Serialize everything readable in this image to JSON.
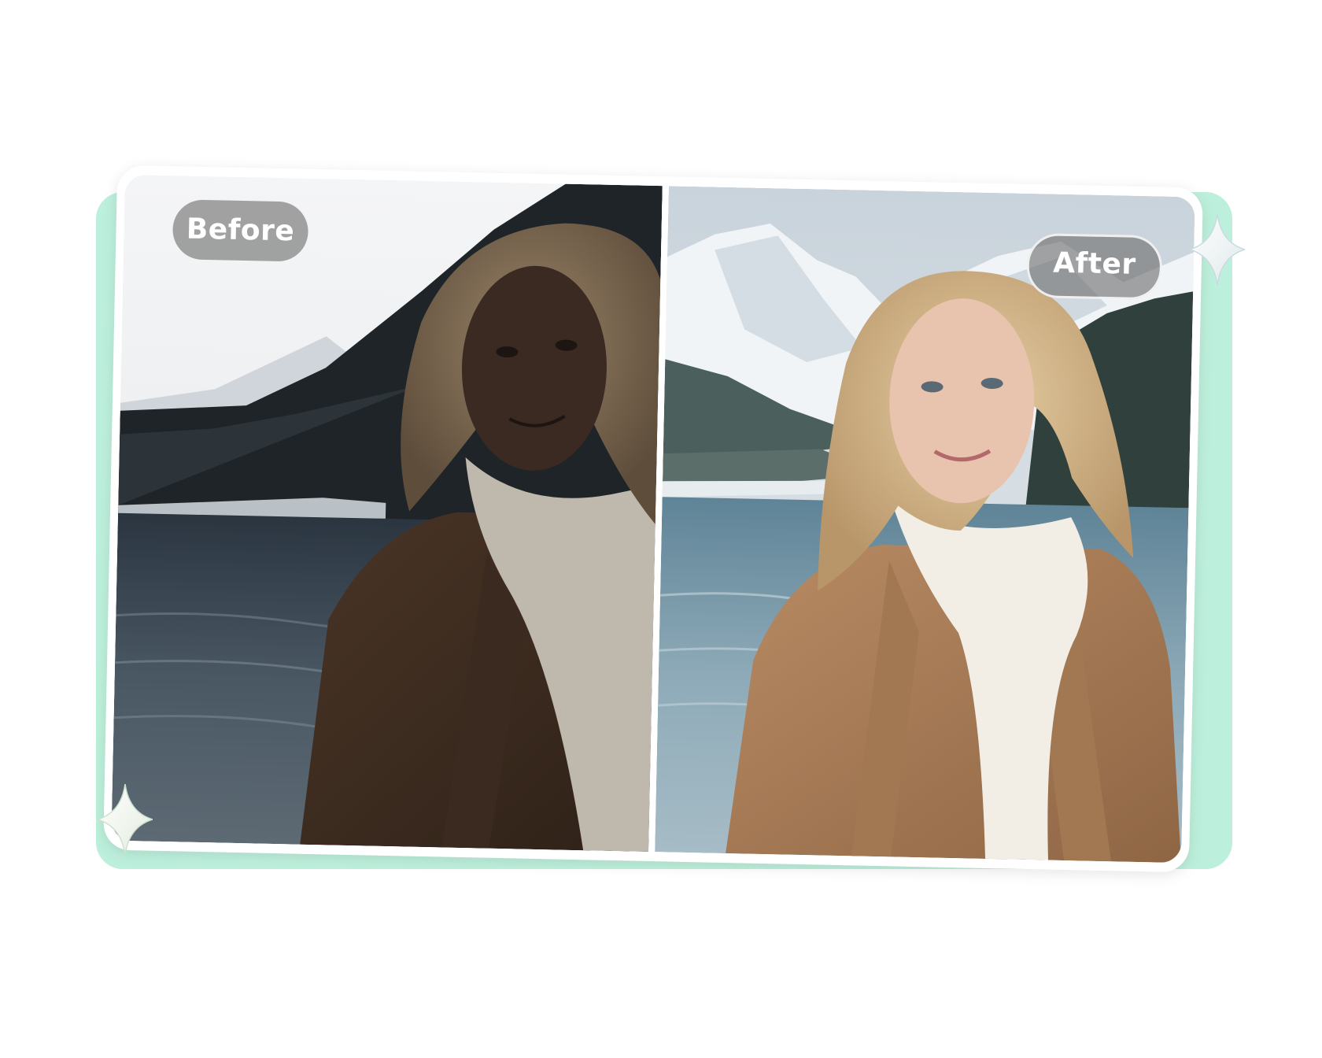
{
  "labels": {
    "before": "Before",
    "after": "After"
  },
  "icons": {
    "sparkle_top_right": "sparkle-icon",
    "sparkle_bottom_left": "sparkle-icon"
  },
  "colors": {
    "backplate": "#bdf0dc",
    "card": "#ffffff",
    "label_pill": "#6e6e6e"
  }
}
